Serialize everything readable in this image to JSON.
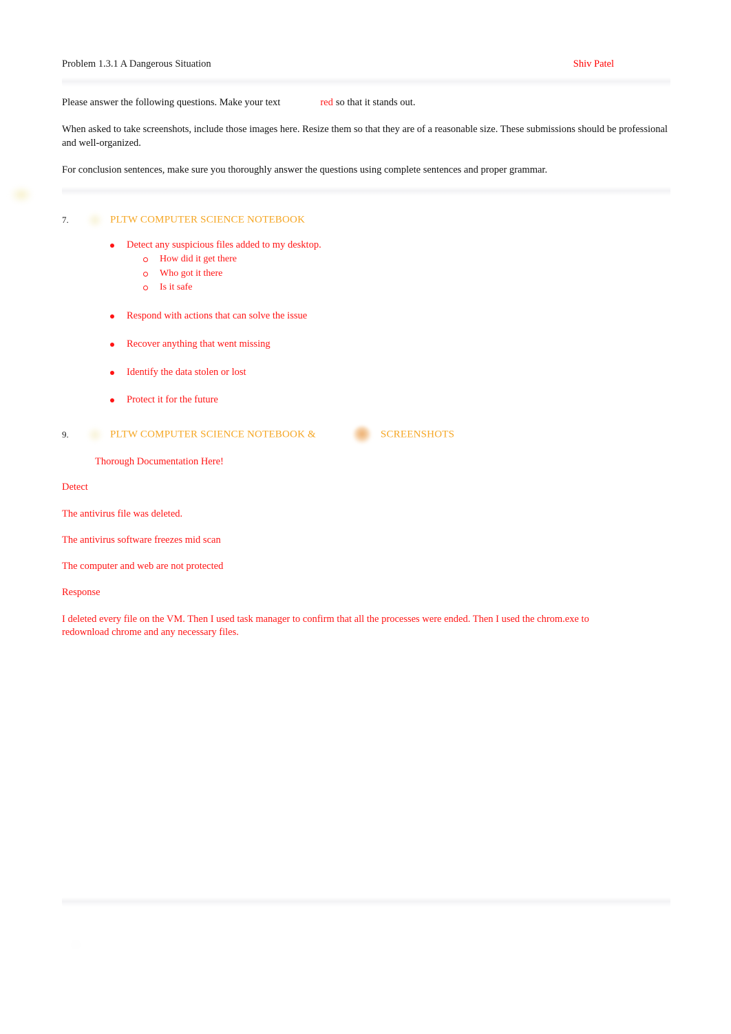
{
  "document": {
    "title": "Problem 1.3.1 A Dangerous Situation",
    "author": "Shiv Patel"
  },
  "colors": {
    "answer_red": "#ff1414",
    "heading_orange": "#f5a623",
    "body_black": "#111111"
  },
  "instructions": {
    "line1_before": "Please answer the following questions. Make your text",
    "line1_red_word": "red",
    "line1_after": "so that it stands out.",
    "line2": "When asked to take screenshots, include those images here. Resize them so that they are of a reasonable size. These submissions should be professional and well-organized.",
    "line3": "For conclusion sentences, make sure you thoroughly answer the questions using complete sentences and proper grammar."
  },
  "items": [
    {
      "number": "7.",
      "heading": "PLTW COMPUTER SCIENCE NOTEBOOK",
      "bullets": [
        {
          "text": "Detect any suspicious files added to my desktop.",
          "sub": [
            "How did it get there",
            "Who got it there",
            "Is it safe"
          ]
        },
        {
          "text": "Respond with actions that can solve the issue",
          "sub": []
        },
        {
          "text": "Recover anything that went missing",
          "sub": []
        },
        {
          "text": "Identify the data stolen or lost",
          "sub": []
        },
        {
          "text": "Protect it for the future",
          "sub": []
        }
      ]
    },
    {
      "number": "9.",
      "heading_part1": "PLTW COMPUTER SCIENCE NOTEBOOK &",
      "heading_part2": "SCREENSHOTS",
      "sub_note": "Thorough Documentation Here!"
    }
  ],
  "answers": {
    "detect_label": "Detect",
    "detect_lines": [
      "The antivirus file was deleted.",
      "The antivirus software freezes mid scan",
      "The computer and web are not protected"
    ],
    "response_label": "Response",
    "response_text": "I deleted every file on the VM. Then I used task manager to confirm that all the processes were ended. Then I used the chrom.exe to redownload chrome and any necessary files."
  },
  "redacted": {
    "note": "Remaining content is blurred and illegible in the source screenshot.",
    "blocks": [
      {
        "label": "",
        "lines": [
          "",
          ""
        ]
      },
      {
        "label": "",
        "lines": [
          ""
        ]
      },
      {
        "label": "",
        "lines": [
          ""
        ]
      },
      {
        "label": "",
        "lines": [
          "",
          ""
        ]
      },
      {
        "label": "",
        "lines": [
          ""
        ]
      },
      {
        "label": "",
        "lines": [
          "",
          "",
          ""
        ]
      }
    ],
    "placeholder_short": "      ",
    "placeholder_line_a": " ",
    "footer_title": " ",
    "footer_item": " "
  }
}
